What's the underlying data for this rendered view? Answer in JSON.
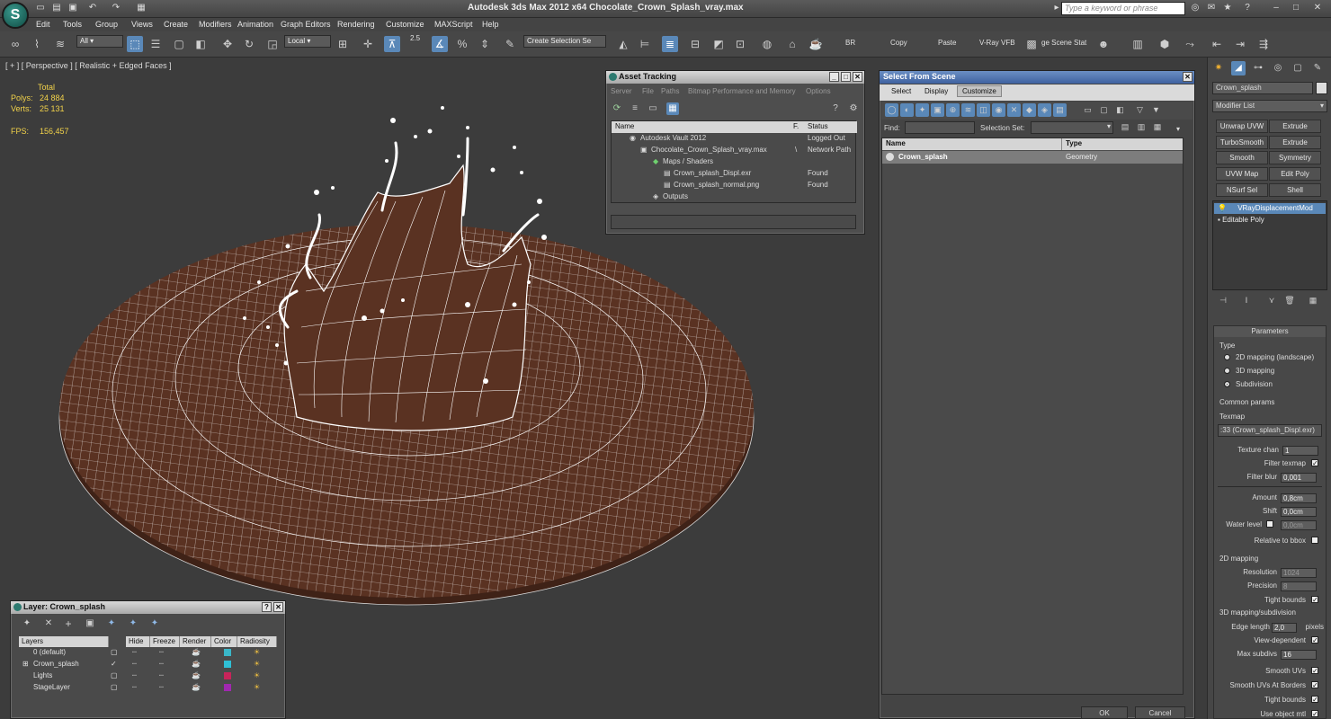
{
  "app": {
    "title": "Autodesk 3ds Max  2012 x64     Chocolate_Crown_Splash_vray.max",
    "search_placeholder": "Type a keyword or phrase",
    "logo": "S"
  },
  "menu": [
    "Edit",
    "Tools",
    "Group",
    "Views",
    "Create",
    "Modifiers",
    "Animation",
    "Graph Editors",
    "Rendering",
    "Customize",
    "MAXScript",
    "Help"
  ],
  "toolbar": {
    "filter": "All",
    "coord": "Local",
    "snap_angle": "2.5",
    "selection_set": "Create Selection Se",
    "br": "BR",
    "copy": "Copy",
    "paste": "Paste",
    "vfb": "V-Ray VFB",
    "scene_states": "ge Scene Stat"
  },
  "viewport": {
    "label": "[ + ] [ Perspective ] [ Realistic + Edged Faces ]",
    "stats": {
      "total_label": "Total",
      "polys_label": "Polys:",
      "polys": "24 884",
      "verts_label": "Verts:",
      "verts": "25 131",
      "fps_label": "FPS:",
      "fps": "156,457"
    },
    "colors": {
      "mesh": "#5a3222",
      "wire": "#ffffff",
      "bg": "#3c3c3c"
    }
  },
  "asset_tracking": {
    "title": "Asset Tracking",
    "menu": [
      "Server",
      "File",
      "Paths",
      "Bitmap Performance and Memory",
      "Options"
    ],
    "columns": [
      "Name",
      "F.",
      "Status"
    ],
    "rows": [
      {
        "name": "Autodesk Vault 2012",
        "f": "",
        "status": "Logged Out"
      },
      {
        "name": "Chocolate_Crown_Splash_vray.max",
        "f": "\\",
        "status": "Network Path"
      },
      {
        "name": "Maps / Shaders",
        "f": "",
        "status": ""
      },
      {
        "name": "Crown_splash_Displ.exr",
        "f": "",
        "status": "Found"
      },
      {
        "name": "Crown_splash_normal.png",
        "f": "",
        "status": "Found"
      },
      {
        "name": "Outputs",
        "f": "",
        "status": ""
      }
    ]
  },
  "select_from_scene": {
    "title": "Select From Scene",
    "tabs": [
      "Select",
      "Display",
      "Customize"
    ],
    "find_label": "Find:",
    "selection_set_label": "Selection Set:",
    "columns": [
      "Name",
      "Type"
    ],
    "rows": [
      {
        "name": "Crown_splash",
        "type": "Geometry"
      }
    ],
    "ok": "OK",
    "cancel": "Cancel"
  },
  "command_panel": {
    "object_name": "Crown_splash",
    "modifier_list": "Modifier List",
    "buttons": [
      "Unwrap UVW",
      "Extrude",
      "TurboSmooth",
      "Extrude",
      "Smooth",
      "Symmetry",
      "UVW Map",
      "Edit Poly",
      "NSurf Sel",
      "Shell"
    ],
    "stack": [
      "VRayDisplacementMod",
      "Editable Poly"
    ],
    "params": {
      "title": "Parameters",
      "type_label": "Type",
      "type_options": [
        "2D mapping (landscape)",
        "3D mapping",
        "Subdivision"
      ],
      "common_label": "Common params",
      "texmap_label": "Texmap",
      "texmap": ":33 (Crown_splash_Displ.exr)",
      "texture_chan_label": "Texture chan",
      "texture_chan": "1",
      "filter_texmap_label": "Filter texmap",
      "filter_blur_label": "Filter blur",
      "filter_blur": "0,001",
      "amount_label": "Amount",
      "amount": "0,8cm",
      "shift_label": "Shift",
      "shift": "0,0cm",
      "water_label": "Water level",
      "water": "0,0cm",
      "relative_label": "Relative to bbox",
      "map2d_label": "2D mapping",
      "resolution_label": "Resolution",
      "resolution": "1024",
      "precision_label": "Precision",
      "precision": "8",
      "tight_label": "Tight bounds",
      "map3d_label": "3D mapping/subdivision",
      "edge_label": "Edge length",
      "edge": "2,0",
      "pixels_label": "pixels",
      "viewdep_label": "View-dependent",
      "maxsub_label": "Max subdivs",
      "maxsub": "16",
      "smoothuv_label": "Smooth UVs",
      "smoothuvb_label": "Smooth UVs At Borders",
      "tight2_label": "Tight bounds",
      "useobj_label": "Use object mtl"
    }
  },
  "layer_panel": {
    "title": "Layer: Crown_splash",
    "columns": [
      "Layers",
      "Hide",
      "Freeze",
      "Render",
      "Color",
      "Radiosity"
    ],
    "rows": [
      {
        "name": "0 (default)",
        "color": "#3ab6c8"
      },
      {
        "name": "Crown_splash",
        "color": "#2fc0d6"
      },
      {
        "name": "Lights",
        "color": "#c8245a"
      },
      {
        "name": "StageLayer",
        "color": "#a028b0"
      }
    ]
  }
}
